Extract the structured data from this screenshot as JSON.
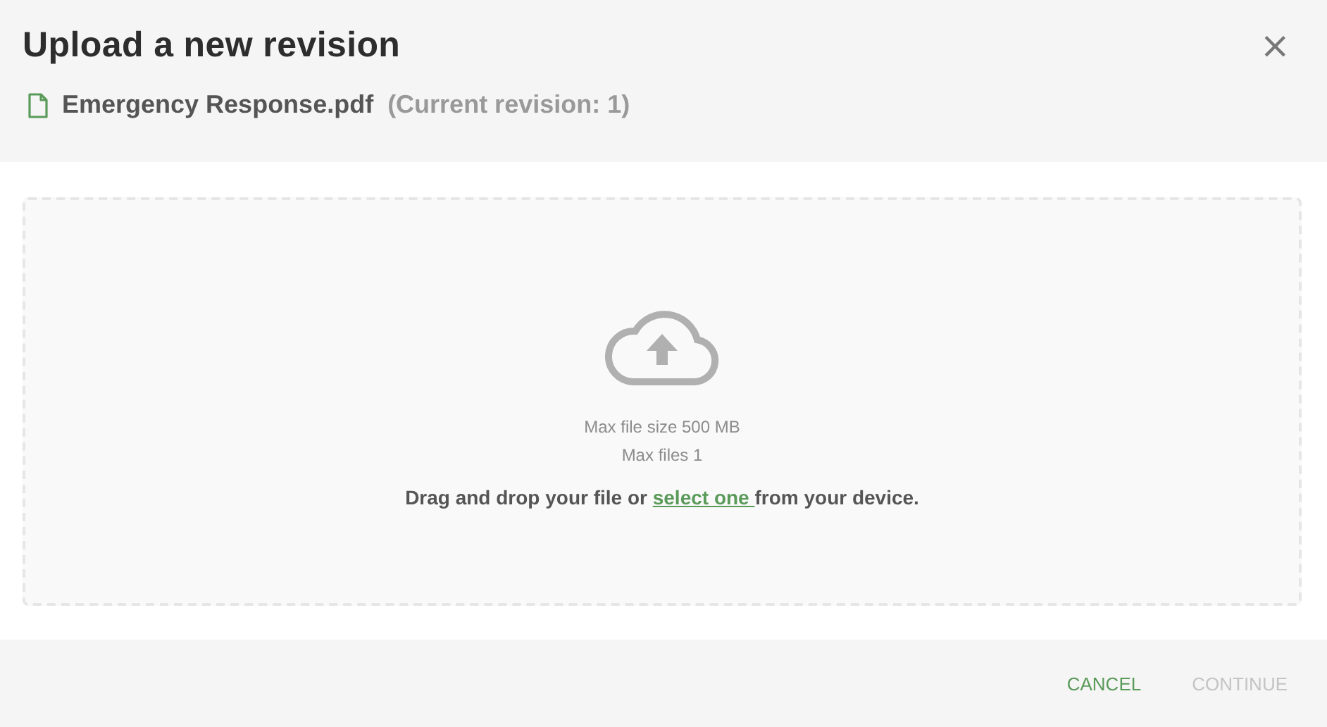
{
  "dialog": {
    "title": "Upload a new revision",
    "close": "×"
  },
  "file": {
    "name": "Emergency Response.pdf",
    "revision": "(Current revision: 1)"
  },
  "dropzone": {
    "limits": [
      "Max file size 500 MB",
      "Max files 1"
    ],
    "instruction": {
      "before": "Drag and drop your file or ",
      "link": "select one ",
      "after": "from your device."
    }
  },
  "buttons": [
    {
      "label": "CANCEL",
      "disabled": false
    },
    {
      "label": "CONTINUE",
      "disabled": true
    }
  ]
}
